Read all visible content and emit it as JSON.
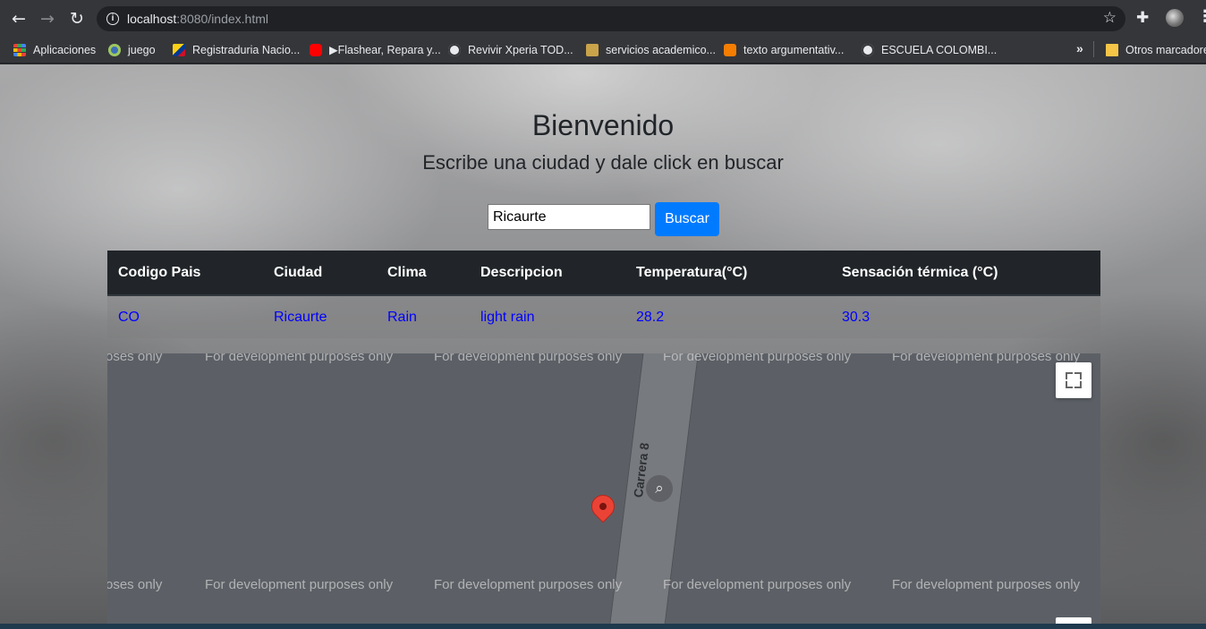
{
  "browser": {
    "url_host": "localhost",
    "url_rest": ":8080/index.html",
    "bookmarks": [
      {
        "label": "Aplicaciones",
        "icon": "apps-grid-icon"
      },
      {
        "label": "juego",
        "icon": "juego-icon"
      },
      {
        "label": "Registraduria Nacio...",
        "icon": "registraduria-icon"
      },
      {
        "label": "▶Flashear, Repara y...",
        "icon": "youtube-icon"
      },
      {
        "label": "Revivir Xperia TOD...",
        "icon": "globe-icon"
      },
      {
        "label": "servicios academico...",
        "icon": "academic-icon"
      },
      {
        "label": "texto argumentativ...",
        "icon": "blogger-icon"
      },
      {
        "label": "ESCUELA COLOMBI...",
        "icon": "globe-icon"
      }
    ],
    "other_bookmarks": "Otros marcadores"
  },
  "page": {
    "title": "Bienvenido",
    "subtitle": "Escribe una ciudad y dale click en buscar",
    "search": {
      "value": "Ricaurte",
      "button_label": "Buscar"
    }
  },
  "table": {
    "headers": [
      "Codigo Pais",
      "Ciudad",
      "Clima",
      "Descripcion",
      "Temperatura(°C)",
      "Sensación térmica (°C)"
    ],
    "rows": [
      [
        "CO",
        "Ricaurte",
        "Rain",
        "light rain",
        "28.2",
        "30.3"
      ]
    ]
  },
  "map": {
    "watermark": "For development purposes only",
    "watermark_partial": "oses only",
    "road_label": "Carrera 8"
  },
  "colors": {
    "accent": "#007bff",
    "table_header": "#212529",
    "link_text": "#0000ff",
    "pin": "#ea4335"
  }
}
